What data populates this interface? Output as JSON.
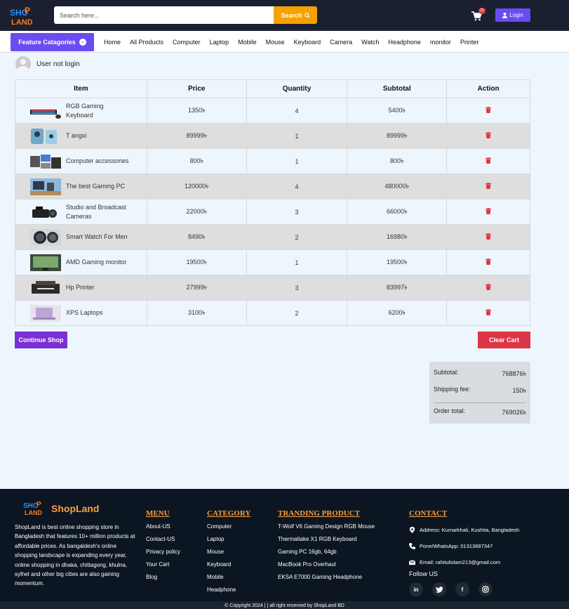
{
  "header": {
    "search_placeholder": "Search here...",
    "search_button": "Search",
    "cart_count": "21",
    "login_label": "Login"
  },
  "nav": {
    "feature_label": "Feature Catagories",
    "links": [
      "Home",
      "All Products",
      "Computer",
      "Laptop",
      "Mobile",
      "Mouse",
      "Keyboard",
      "Camera",
      "Watch",
      "Headphone",
      "monitor",
      "Printer"
    ]
  },
  "user": {
    "status": "User not login"
  },
  "table": {
    "headers": [
      "Item",
      "Price",
      "Quantity",
      "Subtotal",
      "Action"
    ],
    "rows": [
      {
        "name": "RGB Gaming Keyboard",
        "price": "1350৳",
        "qty": "4",
        "subtotal": "5400৳"
      },
      {
        "name": "T angxi",
        "price": "89999৳",
        "qty": "1",
        "subtotal": "89999৳"
      },
      {
        "name": "Computer accessories",
        "price": "800৳",
        "qty": "1",
        "subtotal": "800৳"
      },
      {
        "name": "The best Gaming PC",
        "price": "120000৳",
        "qty": "4",
        "subtotal": "480000৳"
      },
      {
        "name": "Studio and Broadcast Cameras",
        "price": "22000৳",
        "qty": "3",
        "subtotal": "66000৳"
      },
      {
        "name": "Smart Watch For Men",
        "price": "8490৳",
        "qty": "2",
        "subtotal": "16980৳"
      },
      {
        "name": "AMD Gaming monitor",
        "price": "19500৳",
        "qty": "1",
        "subtotal": "19500৳"
      },
      {
        "name": "Hp Printer",
        "price": "27999৳",
        "qty": "3",
        "subtotal": "83997৳"
      },
      {
        "name": "XPS Laptops",
        "price": "3100৳",
        "qty": "2",
        "subtotal": "6200৳"
      }
    ]
  },
  "buttons": {
    "continue": "Continue Shop",
    "clear": "Clear Cart"
  },
  "summary": {
    "subtotal_label": "Subtotal:",
    "subtotal": "768876৳",
    "shipping_label": "Shipping fee:",
    "shipping": "150৳",
    "total_label": "Order total:",
    "total": "769026৳"
  },
  "footer": {
    "brand": "ShopLand",
    "about": "ShopLand is best online shopping store in Bangladesh that features 10+ million products at affordable prices. As bangaldesh's online shopping landscape is expanding every year, online shopping in dhaka, chittagong, khulna, sylhet and other big cities are also gaining momentum.",
    "menu_title": "MENU",
    "menu": [
      "About-US",
      "Contact-US",
      "Privacy policy",
      "Your Cart",
      "Blog"
    ],
    "category_title": "CATEGORY",
    "categories": [
      "Computer",
      "Laptop",
      "Mouse",
      "Keyboard",
      "Mobile",
      "Headphone"
    ],
    "trending_title": "TRANDING PRODUCT",
    "trending": [
      "T-Wolf V6 Gaming Design RGB Mouse",
      "Thermaltake X1 RGB Keyboard",
      "Gaming PC 16gb, 64gb",
      "MacBook Pro Overhaul",
      "EKSA E7000 Gaming Headphone"
    ],
    "contact_title": "CONTACT",
    "address": "Address: Kumarkhali, Kushtia, Bangladesh",
    "phone": "Pone/WhatsApp: 01313687347",
    "email": "Email: rahitulislam213@gmail.com",
    "follow": "Follow US",
    "copyright": "© Copyright 2024 | | all right reserved by ShopLand BD"
  },
  "colors": {
    "accent": "#6a4cf2",
    "search": "#f5a100",
    "danger": "#dc3545",
    "footer_heading": "#ff9d3d"
  }
}
